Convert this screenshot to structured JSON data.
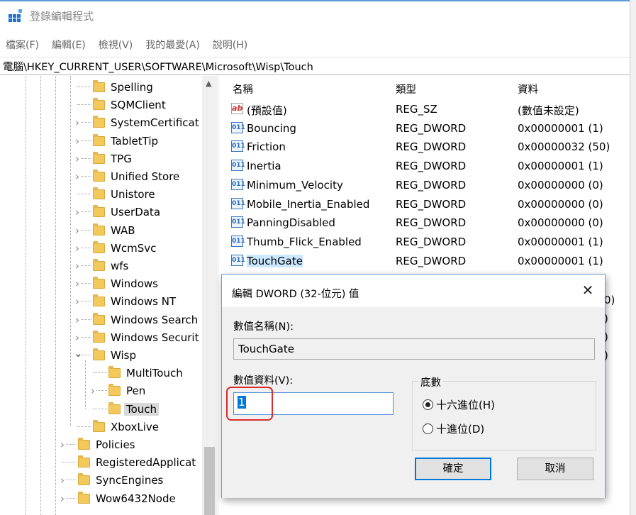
{
  "window": {
    "title": "登錄編輯程式",
    "accent_color": "#1e73d2"
  },
  "menu": [
    "檔案(F)",
    "編輯(E)",
    "檢視(V)",
    "我的最愛(A)",
    "說明(H)"
  ],
  "address": "電腦\\HKEY_CURRENT_USER\\SOFTWARE\\Microsoft\\Wisp\\Touch",
  "tree": [
    {
      "label": "Spelling",
      "depth": 2,
      "expandable": false
    },
    {
      "label": "SQMClient",
      "depth": 2,
      "expandable": false
    },
    {
      "label": "SystemCertificat",
      "depth": 2,
      "expandable": true
    },
    {
      "label": "TabletTip",
      "depth": 2,
      "expandable": true
    },
    {
      "label": "TPG",
      "depth": 2,
      "expandable": true
    },
    {
      "label": "Unified Store",
      "depth": 2,
      "expandable": true
    },
    {
      "label": "Unistore",
      "depth": 2,
      "expandable": false
    },
    {
      "label": "UserData",
      "depth": 2,
      "expandable": true
    },
    {
      "label": "WAB",
      "depth": 2,
      "expandable": true
    },
    {
      "label": "WcmSvc",
      "depth": 2,
      "expandable": true
    },
    {
      "label": "wfs",
      "depth": 2,
      "expandable": true
    },
    {
      "label": "Windows",
      "depth": 2,
      "expandable": true
    },
    {
      "label": "Windows NT",
      "depth": 2,
      "expandable": true
    },
    {
      "label": "Windows Search",
      "depth": 2,
      "expandable": true
    },
    {
      "label": "Windows Securit",
      "depth": 2,
      "expandable": true
    },
    {
      "label": "Wisp",
      "depth": 2,
      "expandable": true,
      "expanded": true
    },
    {
      "label": "MultiTouch",
      "depth": 3,
      "expandable": false
    },
    {
      "label": "Pen",
      "depth": 3,
      "expandable": true
    },
    {
      "label": "Touch",
      "depth": 3,
      "expandable": false,
      "selected": true
    },
    {
      "label": "XboxLive",
      "depth": 2,
      "expandable": false
    },
    {
      "label": "Policies",
      "depth": 1,
      "expandable": true
    },
    {
      "label": "RegisteredApplicat",
      "depth": 1,
      "expandable": false
    },
    {
      "label": "SyncEngines",
      "depth": 1,
      "expandable": true
    },
    {
      "label": "Wow6432Node",
      "depth": 1,
      "expandable": true
    }
  ],
  "list": {
    "headers": {
      "name": "名稱",
      "type": "類型",
      "data": "資料"
    },
    "rows": [
      {
        "name": "(預設值)",
        "type": "REG_SZ",
        "data": "(數值未設定)",
        "icon": "string-value-icon"
      },
      {
        "name": "Bouncing",
        "type": "REG_DWORD",
        "data": "0x00000001 (1)",
        "icon": "dword-value-icon"
      },
      {
        "name": "Friction",
        "type": "REG_DWORD",
        "data": "0x00000032 (50)",
        "icon": "dword-value-icon"
      },
      {
        "name": "Inertia",
        "type": "REG_DWORD",
        "data": "0x00000001 (1)",
        "icon": "dword-value-icon"
      },
      {
        "name": "Minimum_Velocity",
        "type": "REG_DWORD",
        "data": "0x00000000 (0)",
        "icon": "dword-value-icon"
      },
      {
        "name": "Mobile_Inertia_Enabled",
        "type": "REG_DWORD",
        "data": "0x00000000 (0)",
        "icon": "dword-value-icon"
      },
      {
        "name": "PanningDisabled",
        "type": "REG_DWORD",
        "data": "0x00000000 (0)",
        "icon": "dword-value-icon"
      },
      {
        "name": "Thumb_Flick_Enabled",
        "type": "REG_DWORD",
        "data": "0x00000001 (1)",
        "icon": "dword-value-icon"
      },
      {
        "name": "TouchGate",
        "type": "REG_DWORD",
        "data": "0x00000001 (1)",
        "icon": "dword-value-icon",
        "selected": true
      }
    ],
    "partial_right_text": [
      "0)",
      ")",
      ")",
      ")"
    ]
  },
  "dialog": {
    "title": "編輯 DWORD (32-位元) 值",
    "close_glyph": "✕",
    "name_label": "數值名稱(N):",
    "name_value": "TouchGate",
    "data_label": "數值資料(V):",
    "data_value": "1",
    "base_title": "底數",
    "base_options": [
      {
        "label": "十六進位(H)",
        "checked": true
      },
      {
        "label": "十進位(D)",
        "checked": false
      }
    ],
    "ok_label": "確定",
    "cancel_label": "取消",
    "highlight_color": "#d92b2b"
  }
}
